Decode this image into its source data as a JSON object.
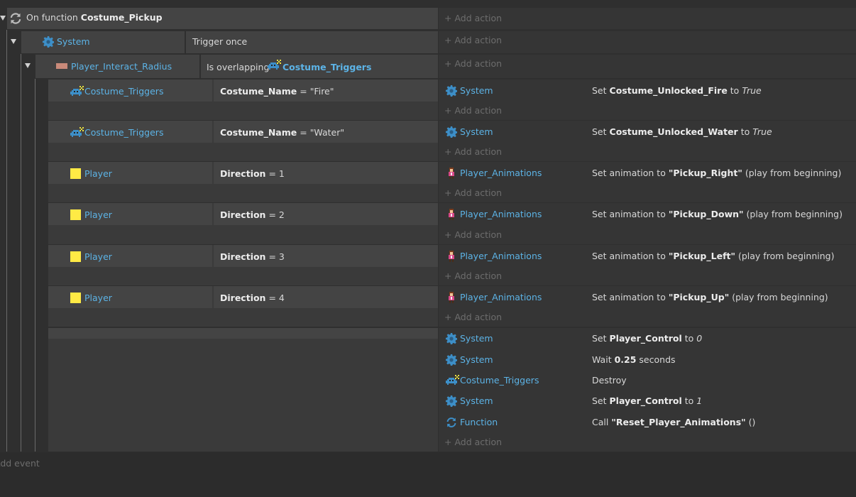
{
  "function_header": {
    "prefix": "On function",
    "name": "Costume_Pickup"
  },
  "add_action": "Add action",
  "add_event": "Add event",
  "level1": {
    "object": "System",
    "condition": "Trigger once"
  },
  "level2": {
    "object": "Player_Interact_Radius",
    "condition_prefix": "Is overlapping",
    "target": "Costume_Triggers"
  },
  "subevents": [
    {
      "object": "Costume_Triggers",
      "var": "Costume_Name",
      "op": "=",
      "value": "\"Fire\"",
      "action_object": "System",
      "action_prefix": "Set",
      "action_var": "Costume_Unlocked_Fire",
      "action_mid": "to",
      "action_value": "True"
    },
    {
      "object": "Costume_Triggers",
      "var": "Costume_Name",
      "op": "=",
      "value": "\"Water\"",
      "action_object": "System",
      "action_prefix": "Set",
      "action_var": "Costume_Unlocked_Water",
      "action_mid": "to",
      "action_value": "True"
    },
    {
      "object": "Player",
      "var": "Direction",
      "op": "=",
      "value": "1",
      "action_object": "Player_Animations",
      "action_prefix": "Set animation to",
      "action_var": "\"Pickup_Right\"",
      "action_suffix": "(play from beginning)"
    },
    {
      "object": "Player",
      "var": "Direction",
      "op": "=",
      "value": "2",
      "action_object": "Player_Animations",
      "action_prefix": "Set animation to",
      "action_var": "\"Pickup_Down\"",
      "action_suffix": "(play from beginning)"
    },
    {
      "object": "Player",
      "var": "Direction",
      "op": "=",
      "value": "3",
      "action_object": "Player_Animations",
      "action_prefix": "Set animation to",
      "action_var": "\"Pickup_Left\"",
      "action_suffix": "(play from beginning)"
    },
    {
      "object": "Player",
      "var": "Direction",
      "op": "=",
      "value": "4",
      "action_object": "Player_Animations",
      "action_prefix": "Set animation to",
      "action_var": "\"Pickup_Up\"",
      "action_suffix": "(play from beginning)"
    }
  ],
  "final_actions": [
    {
      "object": "System",
      "prefix": "Set",
      "var": "Player_Control",
      "mid": "to",
      "value": "0"
    },
    {
      "object": "System",
      "prefix": "Wait",
      "var": "0.25",
      "mid": "seconds"
    },
    {
      "object": "Costume_Triggers",
      "prefix": "Destroy"
    },
    {
      "object": "System",
      "prefix": "Set",
      "var": "Player_Control",
      "mid": "to",
      "value": "1"
    },
    {
      "object": "Function",
      "prefix": "Call",
      "var": "\"Reset_Player_Animations\"",
      "mid": "()"
    }
  ]
}
